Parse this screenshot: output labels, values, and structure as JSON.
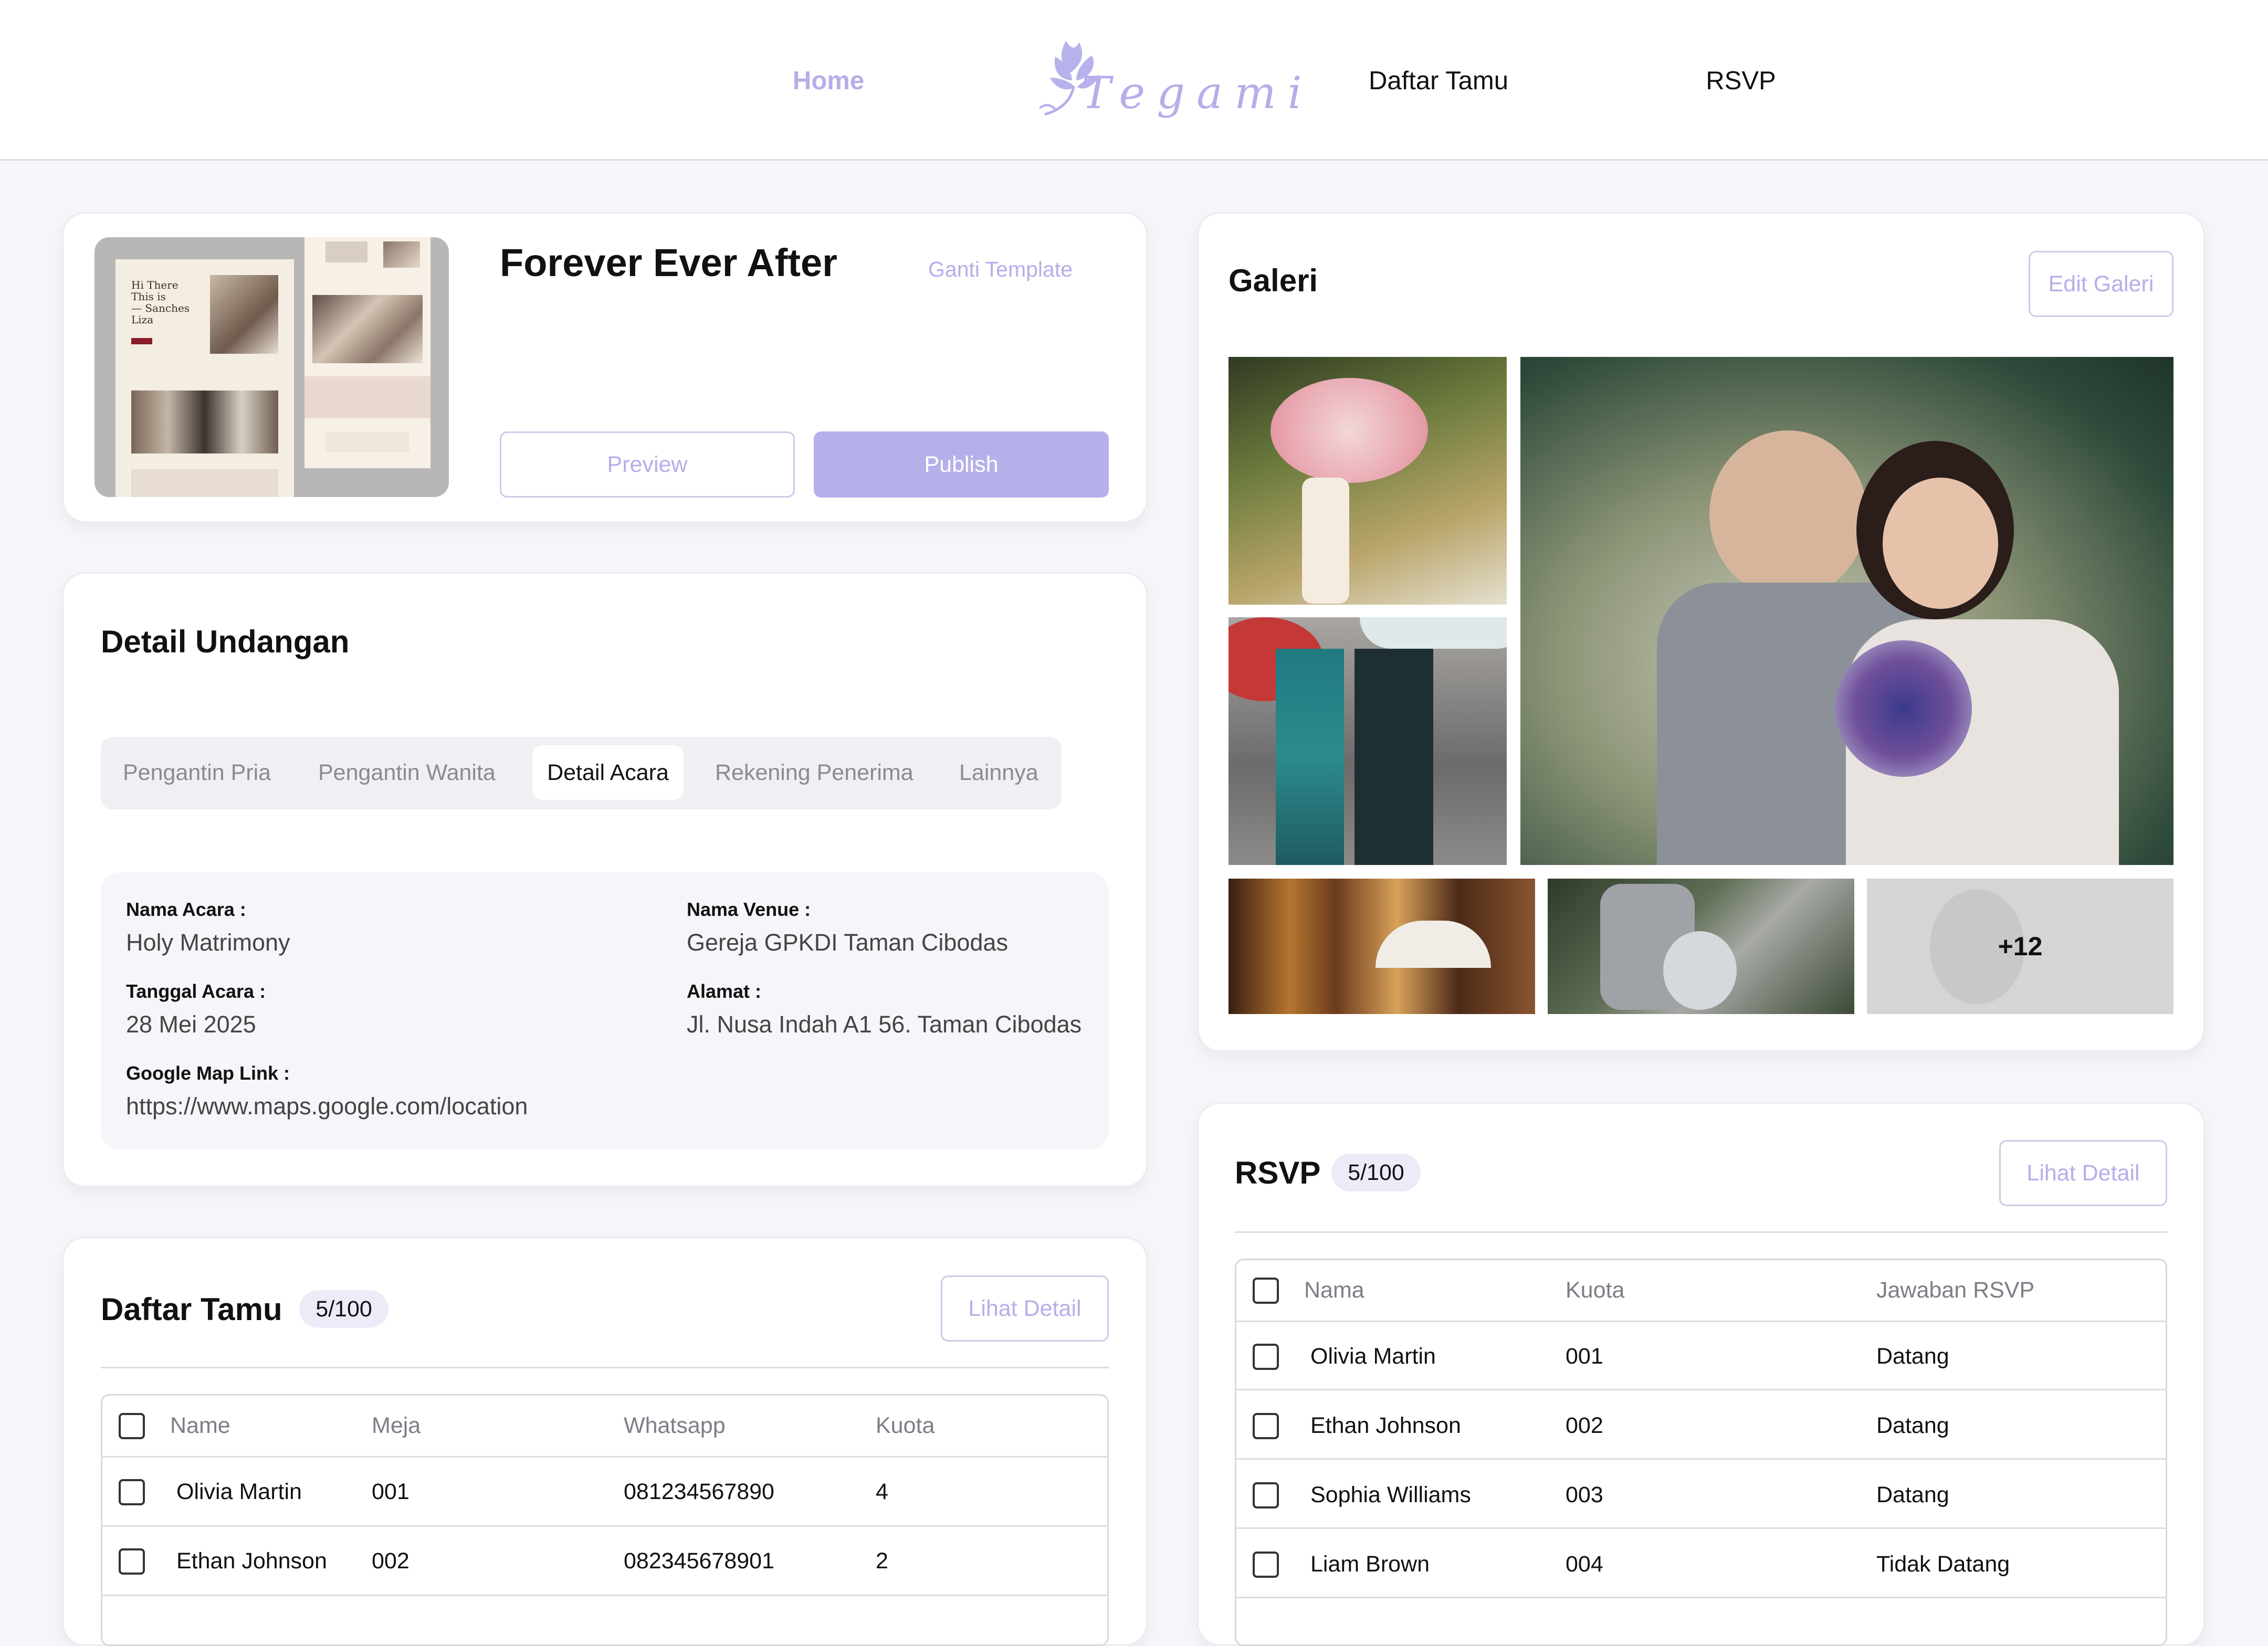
{
  "nav": {
    "home": "Home",
    "logo_text": "Tegami",
    "guests": "Daftar Tamu",
    "rsvp": "RSVP"
  },
  "template_card": {
    "title": "Forever Ever After",
    "change_template": "Ganti Template",
    "preview": "Preview",
    "publish": "Publish",
    "preview_snippets": {
      "greeting_1": "Hi There",
      "greeting_2": "This is",
      "greeting_3": "— Sanches",
      "greeting_4": "Liza"
    }
  },
  "invitation_detail": {
    "title": "Detail Undangan",
    "tabs": [
      {
        "label": "Pengantin Pria",
        "active": false
      },
      {
        "label": "Pengantin Wanita",
        "active": false
      },
      {
        "label": "Detail Acara",
        "active": true
      },
      {
        "label": "Rekening Penerima",
        "active": false
      },
      {
        "label": "Lainnya",
        "active": false
      }
    ],
    "fields": {
      "event_name_label": "Nama Acara :",
      "event_name": "Holy Matrimony",
      "venue_label": "Nama Venue :",
      "venue": "Gereja GPKDI Taman Cibodas",
      "date_label": "Tanggal Acara :",
      "date": "28 Mei 2025",
      "address_label": "Alamat :",
      "address": "Jl. Nusa Indah A1 56. Taman Cibodas",
      "map_label": "Google Map Link :",
      "map": "https://www.maps.google.com/location"
    }
  },
  "guest_list": {
    "title": "Daftar Tamu",
    "count": "5/100",
    "detail_button": "Lihat Detail",
    "columns": [
      "Name",
      "Meja",
      "Whatsapp",
      "Kuota"
    ],
    "rows": [
      {
        "name": "Olivia Martin",
        "table": "001",
        "whatsapp": "081234567890",
        "quota": "4"
      },
      {
        "name": "Ethan Johnson",
        "table": "002",
        "whatsapp": "082345678901",
        "quota": "2"
      }
    ]
  },
  "gallery": {
    "title": "Galeri",
    "edit_button": "Edit Galeri",
    "more_count": "+12"
  },
  "rsvp": {
    "title": "RSVP",
    "count": "5/100",
    "detail_button": "Lihat Detail",
    "columns": [
      "Nama",
      "Kuota",
      "Jawaban RSVP"
    ],
    "rows": [
      {
        "name": "Olivia Martin",
        "quota": "001",
        "answer": "Datang"
      },
      {
        "name": "Ethan Johnson",
        "quota": "002",
        "answer": "Datang"
      },
      {
        "name": "Sophia Williams",
        "quota": "003",
        "answer": "Datang"
      },
      {
        "name": "Liam Brown",
        "quota": "004",
        "answer": "Tidak Datang"
      }
    ]
  },
  "colors": {
    "accent": "#b4aeea",
    "background": "#f6f6fa",
    "card": "#ffffff"
  }
}
